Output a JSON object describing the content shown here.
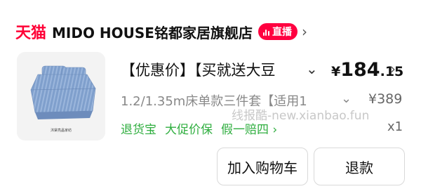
{
  "store": {
    "platform_logo": "天猫",
    "name": "MIDO HOUSE铭都家居旗舰店",
    "live_badge": "直播",
    "chevron": "›"
  },
  "product": {
    "image_label": "沐棠亮晶家纺",
    "title": "【优惠价】【买就送大豆",
    "title_chevron": "⌄",
    "price_symbol": "¥",
    "price_integer": "184",
    "price_decimal": ".15",
    "price_chevron": "›",
    "spec": "1.2/1.35m床单款三件套【适用1",
    "spec_chevron": "⌄",
    "original_price": "¥389",
    "quantity": "x1",
    "services": [
      "退货宝",
      "大促价保",
      "假一赔四 ›"
    ]
  },
  "watermark": "线报酷-new.xianbao.fun",
  "buttons": {
    "add_to_cart": "加入购物车",
    "refund": "退款"
  },
  "colors": {
    "tmall_red": "#ff0036",
    "live_badge": "#ff0040",
    "service_green": "#2fae3f",
    "sheet_blue": "#7f9fcc"
  }
}
